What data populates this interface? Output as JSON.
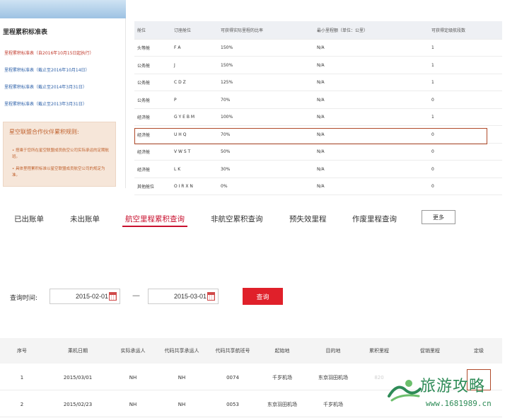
{
  "left_panel": {
    "title": "里程累积标准表",
    "links": [
      "里程累积标准表（自2016年10月15日起执行）",
      "里程累积标准表（截止至2016年10月14日）",
      "里程累积标准表（截止至2014年3月31日）",
      "里程累积标准表（截止至2013年3月31日）"
    ],
    "partner_title": "星空联盟合作伙伴累积规则:",
    "partner_notes": [
      "• 搭乘于您所在星空联盟成员航空公司实际承运的定期航班。",
      "• 具体里程累积标准以星空联盟成员航空公司的规定为准。"
    ]
  },
  "fare_table": {
    "headers": [
      "舱位",
      "订座舱位",
      "可获得实际里程的比率",
      "最小里程额（单位：公里）",
      "可获得定级航段数"
    ],
    "rows": [
      [
        "头等舱",
        "F A",
        "150%",
        "N/A",
        "1"
      ],
      [
        "公务舱",
        "J",
        "150%",
        "N/A",
        "1"
      ],
      [
        "公务舱",
        "C D Z",
        "125%",
        "N/A",
        "1"
      ],
      [
        "公务舱",
        "P",
        "70%",
        "N/A",
        "0"
      ],
      [
        "经济舱",
        "G Y E B M",
        "100%",
        "N/A",
        "1"
      ],
      [
        "经济舱",
        "U H Q",
        "70%",
        "N/A",
        "0"
      ],
      [
        "经济舱",
        "V W S T",
        "50%",
        "N/A",
        "0"
      ],
      [
        "经济舱",
        "L K",
        "30%",
        "N/A",
        "0"
      ],
      [
        "其他舱位",
        "O I R X N",
        "0%",
        "N/A",
        "0"
      ]
    ]
  },
  "tabs": [
    "已出账单",
    "未出账单",
    "航空里程累积查询",
    "非航空累积查询",
    "预失效里程",
    "作废里程查询"
  ],
  "more_label": "更多",
  "query": {
    "label": "查询时间:",
    "start_date": "2015-02-01",
    "end_date": "2015-03-01",
    "dash": "—",
    "button": "查询"
  },
  "result_table": {
    "headers": [
      "序号",
      "乘机日期",
      "实际承运人",
      "代码共享承运人",
      "代码共享航班号",
      "起始地",
      "目的地",
      "累积里程",
      "促销里程",
      "定级"
    ],
    "rows": [
      [
        "1",
        "2015/03/01",
        "NH",
        "NH",
        "0074",
        "千岁机场",
        "东京羽田机场",
        "820",
        "",
        ""
      ],
      [
        "2",
        "2015/02/23",
        "NH",
        "NH",
        "0053",
        "东京羽田机场",
        "千岁机场",
        "",
        "",
        ""
      ]
    ]
  },
  "watermark": {
    "text": "旅游攻略",
    "url": "www.1681989.cn"
  }
}
